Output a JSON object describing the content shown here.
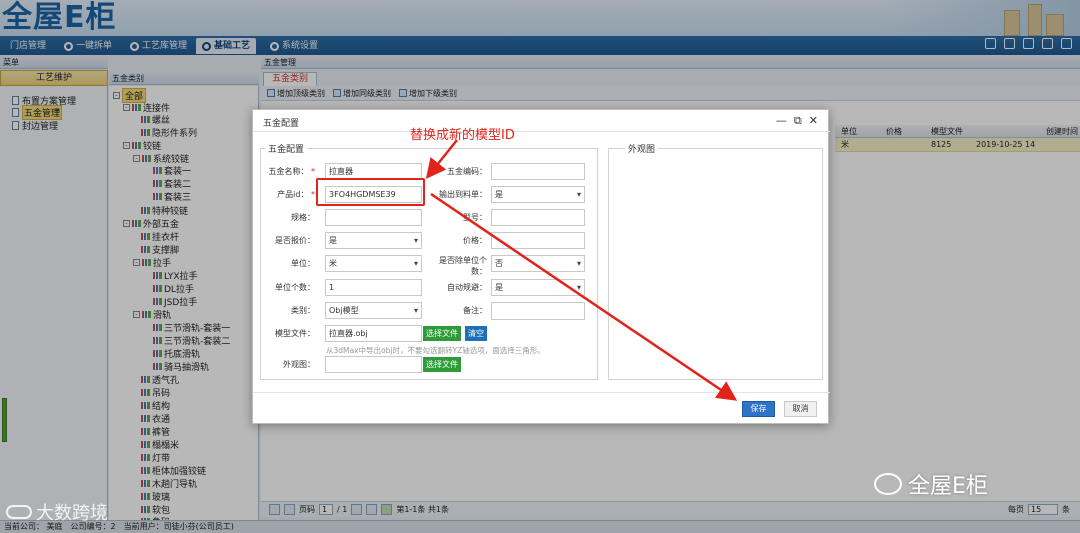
{
  "app": {
    "logo": "全屋E柜"
  },
  "nav": {
    "items": [
      "门店管理",
      "一键拆单",
      "工艺库管理",
      "基础工艺",
      "系统设置"
    ],
    "active_index": 3
  },
  "left": {
    "menu_title": "菜单",
    "section_title": "工艺维护",
    "items": [
      "布置方案管理",
      "五金管理",
      "封边管理"
    ],
    "selected_index": 1
  },
  "tree": {
    "title": "五金类别",
    "nodes": {
      "root": "全部",
      "connectors": "连接件",
      "screw": "螺丝",
      "hidden": "隐形件系列",
      "hinge": "铰链",
      "sys_hinge": "系统铰链",
      "s1": "套装一",
      "s2": "套装二",
      "s3": "套装三",
      "special": "特种铰链",
      "external": "外部五金",
      "pole": "挂衣杆",
      "foot": "支撑脚",
      "handle": "拉手",
      "lyx": "LYX拉手",
      "dl": "DL拉手",
      "jsd": "JSD拉手",
      "rail": "滑轨",
      "r1": "三节滑轨-套装一",
      "r2": "三节滑轨-套装二",
      "r3": "托底滑轨",
      "r4": "骑马抽滑轨",
      "vent": "透气孔",
      "hook": "吊码",
      "struct": "结构",
      "clothes": "衣通",
      "tube": "裤管",
      "rice": "榻榻米",
      "light": "灯带",
      "cab_hinge": "柜体加强铰链",
      "door_rail": "木趟门导轨",
      "glass": "玻璃",
      "soft": "软包",
      "horse": "角码"
    }
  },
  "main": {
    "title": "五金管理",
    "tab": "五金类别",
    "tools": [
      "增加顶级类别",
      "增加同级类别",
      "增加下级类别"
    ],
    "grid": {
      "headers": [
        "单位",
        "价格",
        "模型文件",
        "创建时间"
      ],
      "row": [
        "米",
        "",
        "8125",
        "2019-10-25 14"
      ]
    },
    "pager": {
      "page_label": "页码",
      "page": "1",
      "of": "/ 1",
      "info": "第1-1条  共1条",
      "page_size_label": "每页",
      "page_size": "15",
      "unit": "条"
    }
  },
  "statusbar": {
    "company": "当前公司：  美庭",
    "company_no": "公司编号：2",
    "user": "当前用户：司徒小芬(公司员工)"
  },
  "dialog": {
    "title": "五金配置",
    "left_legend": "五金配置",
    "right_legend": "外观图",
    "fields": {
      "name_label": "五金名称：",
      "name_value": "拉直器",
      "code_label": "五金编码：",
      "code_value": "",
      "pid_label": "产品id：",
      "pid_value": "3FO4HGDMSE39",
      "bom_label": "输出到料单：",
      "bom_value": "是",
      "spec_label": "规格：",
      "spec_value": "",
      "model_label": "型号：",
      "model_value": "",
      "quote_label": "是否报价：",
      "quote_value": "是",
      "price_label": "价格：",
      "price_value": "",
      "unit_label": "单位：",
      "unit_value": "米",
      "divide_label": "是否除单位个数：",
      "divide_value": "否",
      "count_label": "单位个数：",
      "count_value": "1",
      "auto_label": "自动规避：",
      "auto_value": "是",
      "type_label": "类别：",
      "type_value": "Obj模型",
      "remark_label": "备注：",
      "remark_value": "",
      "file_label": "模型文件：",
      "file_value": "拉直器.obj",
      "choose_btn": "选择文件",
      "clear_btn": "清空",
      "hint": "从3dMax中导出obj时，不要勾选翻转YZ轴选项，面选择三角形。",
      "appearance_label": "外观图：",
      "appearance_value": "",
      "choose_btn2": "选择文件"
    },
    "save": "保存",
    "cancel": "取消"
  },
  "annotation": {
    "text": "替换成新的模型ID",
    "color": "#e2231a"
  },
  "watermark": {
    "right": "全屋E柜",
    "left": "大数跨境"
  }
}
